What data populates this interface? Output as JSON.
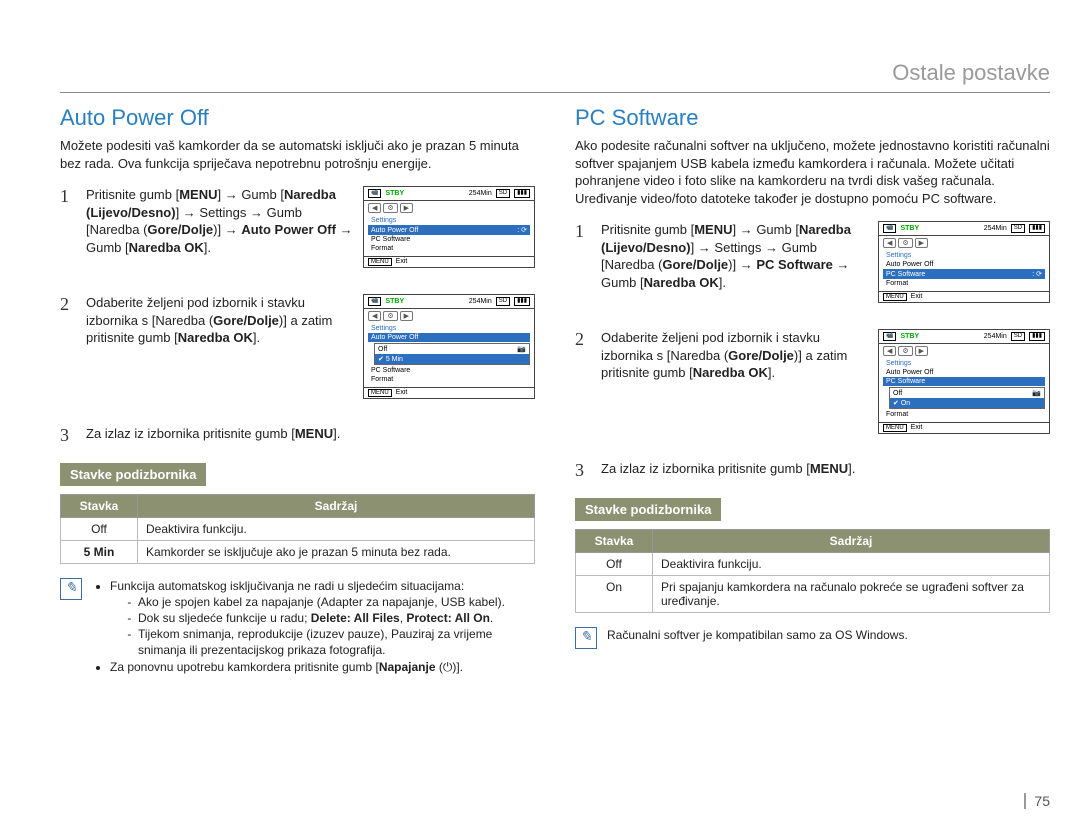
{
  "header": "Ostale postavke",
  "pageNumber": "75",
  "left": {
    "h2": "Auto Power Off",
    "intro": "Možete podesiti vaš kamkorder da se automatski isključi ako je prazan 5 minuta bez rada. Ova funkcija spriječava nepotrebnu potrošnju energije.",
    "step1_a": "Pritisnite gumb [",
    "step1_menu": "MENU",
    "step1_b": "] → Gumb [",
    "step1_nar": "Naredba (Lijevo/Desno)",
    "step1_c": "] → Settings → Gumb [Naredba (",
    "step1_gd": "Gore/Dolje",
    "step1_d": ")] → ",
    "step1_apo": "Auto Power Off",
    "step1_e": " → Gumb [",
    "step1_ok": "Naredba OK",
    "step1_f": "].",
    "step2": "Odaberite željeni pod izbornik i stavku izbornika s [Naredba (",
    "step2_gd": "Gore/Dolje",
    "step2_b": ")] a zatim pritisnite gumb [",
    "step2_ok": "Naredba OK",
    "step2_c": "].",
    "step3": "Za izlaz iz izbornika pritisnite gumb [",
    "step3_menu": "MENU",
    "step3_b": "].",
    "submenuTitle": "Stavke podizbornika",
    "table": {
      "h1": "Stavka",
      "h2": "Sadržaj",
      "rows": [
        {
          "k": "Off",
          "v": "Deaktivira funkciju."
        },
        {
          "k": "5 Min",
          "v": "Kamkorder se isključuje ako je prazan 5 minuta bez rada."
        }
      ]
    },
    "note1": "Funkcija automatskog isključivanja ne radi u sljedećim situacijama:",
    "note1a": "Ako je spojen kabel za napajanje (Adapter za napajanje, USB kabel).",
    "note1b_a": "Dok su sljedeće funkcije u radu; ",
    "note1b_b": "Delete: All Files",
    "note1b_c": ", ",
    "note1b_d": "Protect: All On",
    "note1b_e": ".",
    "note1c": "Tijekom snimanja, reprodukcije (izuzev pauze), Pauziraj za vrijeme snimanja ili prezentacijskog prikaza fotografija.",
    "note2_a": "Za ponovnu upotrebu kamkordera pritisnite gumb [",
    "note2_b": "Napajanje",
    "note2_c": " (⏻)].",
    "mini": {
      "stby": "STBY",
      "time": "254Min",
      "exit": "Exit",
      "menu": "MENU",
      "settings": "Settings",
      "apo": "Auto Power Off",
      "pcs": "PC Software",
      "format": "Format",
      "off": "Off",
      "fivemin": "5 Min"
    }
  },
  "right": {
    "h2": "PC Software",
    "intro": "Ako podesite računalni softver na uključeno, možete jednostavno koristiti računalni softver spajanjem USB kabela između kamkordera i računala. Možete učitati pohranjene video i foto slike na kamkorderu na tvrdi disk vašeg računala. Uređivanje video/foto datoteke također je dostupno pomoću PC software.",
    "step1_a": "Pritisnite gumb [",
    "step1_menu": "MENU",
    "step1_b": "] → Gumb [",
    "step1_nar": "Naredba (Lijevo/Desno)",
    "step1_c": "] → Settings → Gumb [Naredba (",
    "step1_gd": "Gore/Dolje",
    "step1_d": ")] → ",
    "step1_item": "PC Software",
    "step1_e": " → Gumb [",
    "step1_ok": "Naredba OK",
    "step1_f": "].",
    "step2": "Odaberite željeni pod izbornik i stavku izbornika s [Naredba (",
    "step2_gd": "Gore/Dolje",
    "step2_b": ")] a zatim pritisnite gumb [",
    "step2_ok": "Naredba OK",
    "step2_c": "].",
    "step3": "Za izlaz iz izbornika pritisnite gumb [",
    "step3_menu": "MENU",
    "step3_b": "].",
    "submenuTitle": "Stavke podizbornika",
    "table": {
      "h1": "Stavka",
      "h2": "Sadržaj",
      "rows": [
        {
          "k": "Off",
          "v": "Deaktivira funkciju."
        },
        {
          "k": "On",
          "v": "Pri spajanju kamkordera na računalo pokreće se ugrađeni softver za uređivanje."
        }
      ]
    },
    "note": "Računalni softver je kompatibilan samo za OS Windows.",
    "mini": {
      "stby": "STBY",
      "time": "254Min",
      "exit": "Exit",
      "menu": "MENU",
      "settings": "Settings",
      "apo": "Auto Power Off",
      "pcs": "PC Software",
      "format": "Format",
      "off": "Off",
      "on": "On"
    }
  }
}
